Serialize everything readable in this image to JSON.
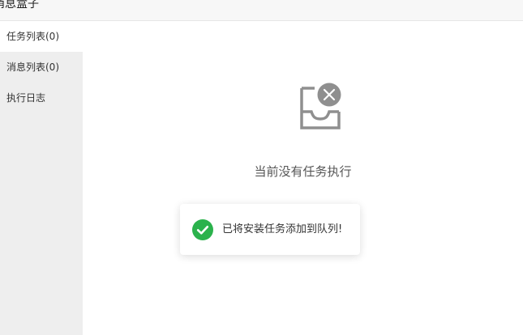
{
  "window": {
    "title": "消息盒子"
  },
  "sidebar": {
    "items": [
      {
        "label": "任务列表(0)",
        "active": true
      },
      {
        "label": "消息列表(0)",
        "active": false
      },
      {
        "label": "执行日志",
        "active": false
      }
    ]
  },
  "main": {
    "empty_icon": "empty-tray-with-close-icon",
    "empty_message": "当前没有任务执行"
  },
  "toast": {
    "icon": "check-circle-icon",
    "message": "已将安装任务添加到队列!",
    "accent_color": "#2bb24c"
  },
  "colors": {
    "sidebar_bg": "#eeeeee",
    "icon_gray": "#8f8f8f"
  }
}
